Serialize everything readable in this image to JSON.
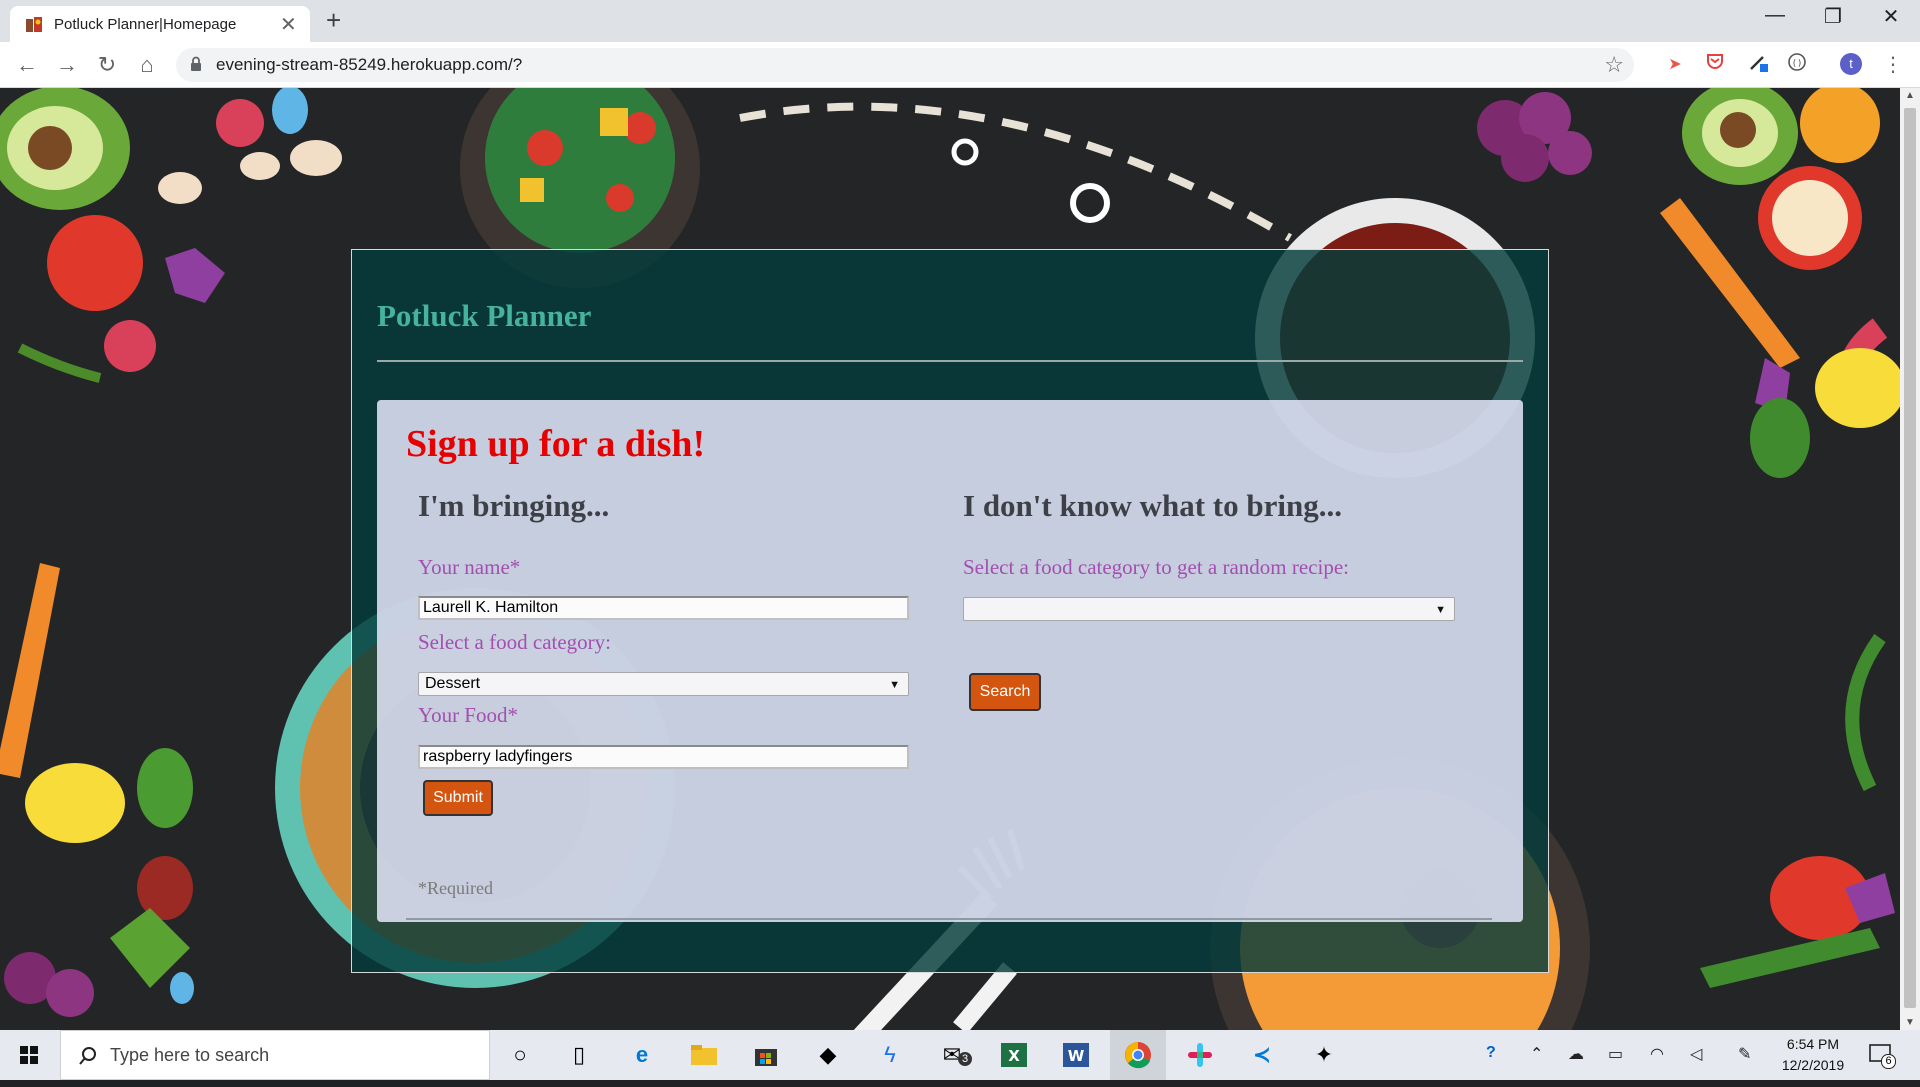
{
  "browser": {
    "tab_title": "Potluck Planner|Homepage",
    "tab_close": "✕",
    "new_tab": "+",
    "url": "evening-stream-85249.herokuapp.com/?",
    "window_controls": {
      "minimize": "—",
      "restore": "❐",
      "close": "✕"
    },
    "profile_initial": "t"
  },
  "app": {
    "title": "Potluck Planner",
    "card_heading": "Sign up for a dish!",
    "left_column": {
      "heading": "I'm bringing...",
      "name_label": "Your name*",
      "name_value": "Laurell K. Hamilton",
      "category_label": "Select a food category:",
      "category_value": "Dessert",
      "food_label": "Your Food*",
      "food_value": "raspberry ladyfingers",
      "submit_label": "Submit",
      "required_note": "*Required"
    },
    "right_column": {
      "heading": "I don't know what to bring...",
      "category_label": "Select a food category to get a random recipe:",
      "category_value": "",
      "search_label": "Search"
    }
  },
  "taskbar": {
    "search_placeholder": "Type here to search",
    "mail_badge": "3",
    "clock_time": "6:54 PM",
    "clock_date": "12/2/2019",
    "notification_count": "6"
  },
  "colors": {
    "panel_bg": "#043c3a",
    "app_title": "#46b39f",
    "card_heading": "#e60000",
    "field_label": "#a24fb0",
    "button": "#d4550f"
  }
}
